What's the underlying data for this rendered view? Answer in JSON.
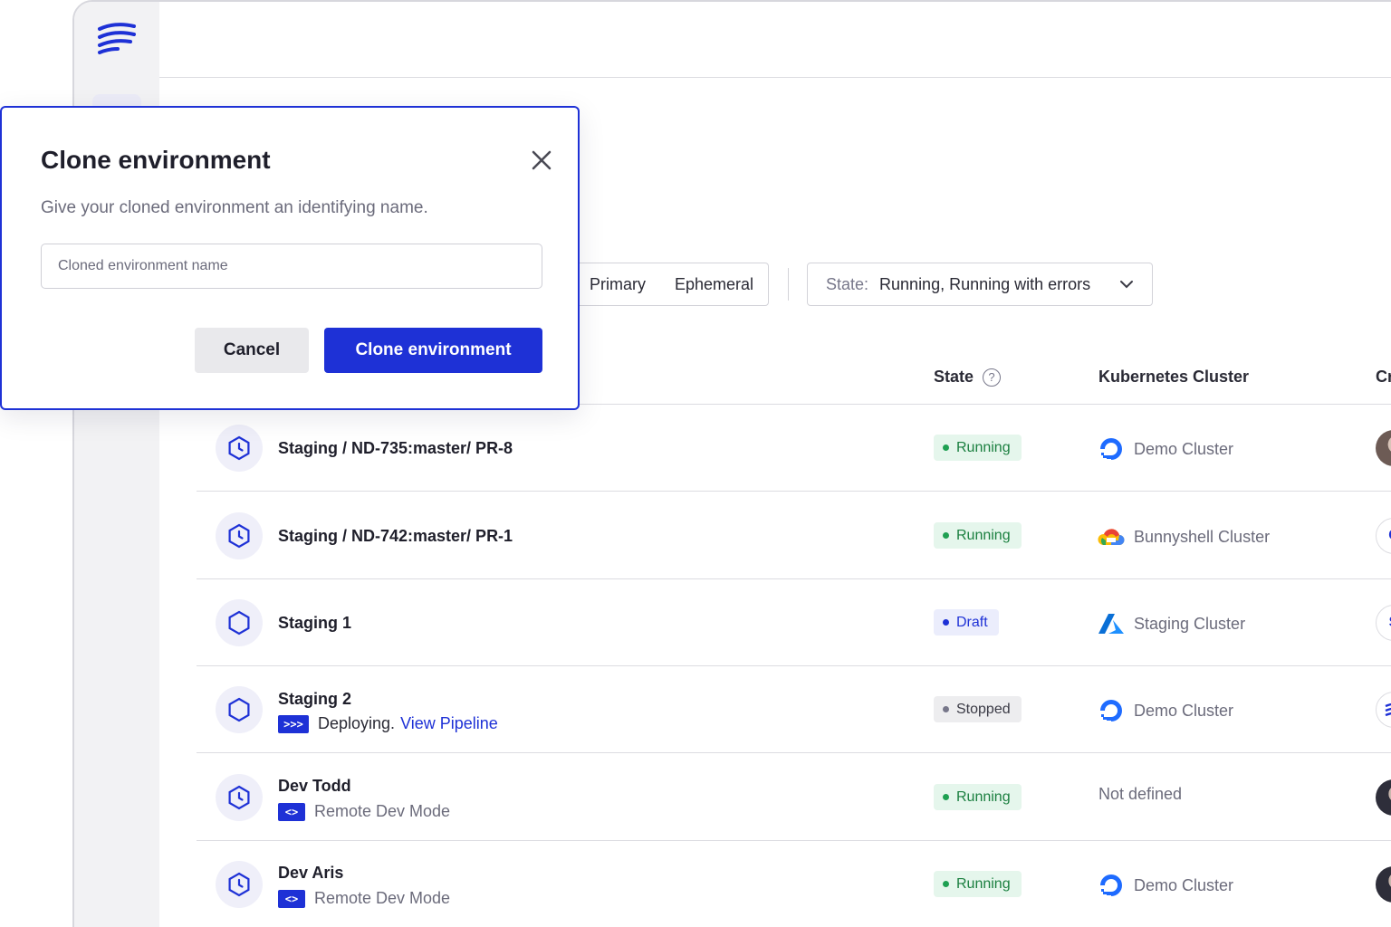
{
  "filters": {
    "type_options": [
      "Primary",
      "Ephemeral"
    ],
    "state_label": "State:",
    "state_value": "Running, Running with errors"
  },
  "table": {
    "headers": {
      "state": "State",
      "state_help": "?",
      "cluster": "Kubernetes Cluster",
      "creator": "Cr"
    },
    "rows": [
      {
        "name": "Staging / ND-735:master/ PR-8",
        "icon": "clock-hexagon-icon",
        "state": "Running",
        "cluster": "Demo Cluster",
        "cluster_icon": "digitalocean-icon",
        "creator_icon": "avatar-photo"
      },
      {
        "name": "Staging / ND-742:master/ PR-1",
        "icon": "clock-hexagon-icon",
        "state": "Running",
        "cluster": "Bunnyshell Cluster",
        "cluster_icon": "google-cloud-icon",
        "creator_initial": "C"
      },
      {
        "name": "Staging 1",
        "icon": "hexagon-icon",
        "state": "Draft",
        "cluster": "Staging Cluster",
        "cluster_icon": "azure-icon",
        "creator_initial": "S"
      },
      {
        "name": "Staging 2",
        "icon": "hexagon-icon",
        "sub_text": "Deploying.",
        "sub_link": "View Pipeline",
        "sub_badge": ">>>",
        "state": "Stopped",
        "cluster": "Demo Cluster",
        "cluster_icon": "digitalocean-icon",
        "creator_icon": "bunnyshell-logo-icon"
      },
      {
        "name": "Dev Todd",
        "icon": "clock-hexagon-icon",
        "sub_text": "Remote Dev Mode",
        "sub_badge": "<>",
        "state": "Running",
        "cluster": "Not defined",
        "creator_icon": "avatar-photo"
      },
      {
        "name": "Dev Aris",
        "icon": "clock-hexagon-icon",
        "sub_text": "Remote Dev Mode",
        "sub_badge": "<>",
        "state": "Running",
        "cluster": "Demo Cluster",
        "cluster_icon": "digitalocean-icon",
        "creator_icon": "avatar-photo"
      }
    ]
  },
  "modal": {
    "title": "Clone environment",
    "description": "Give your cloned environment an identifying name.",
    "input_placeholder": "Cloned environment name",
    "input_value": "",
    "cancel_label": "Cancel",
    "confirm_label": "Clone environment"
  },
  "colors": {
    "accent": "#1e31d6",
    "running_bg": "#e5f6ec",
    "running_text": "#1a7f3f",
    "draft_bg": "#ebedfc",
    "stopped_bg": "#ededef"
  }
}
